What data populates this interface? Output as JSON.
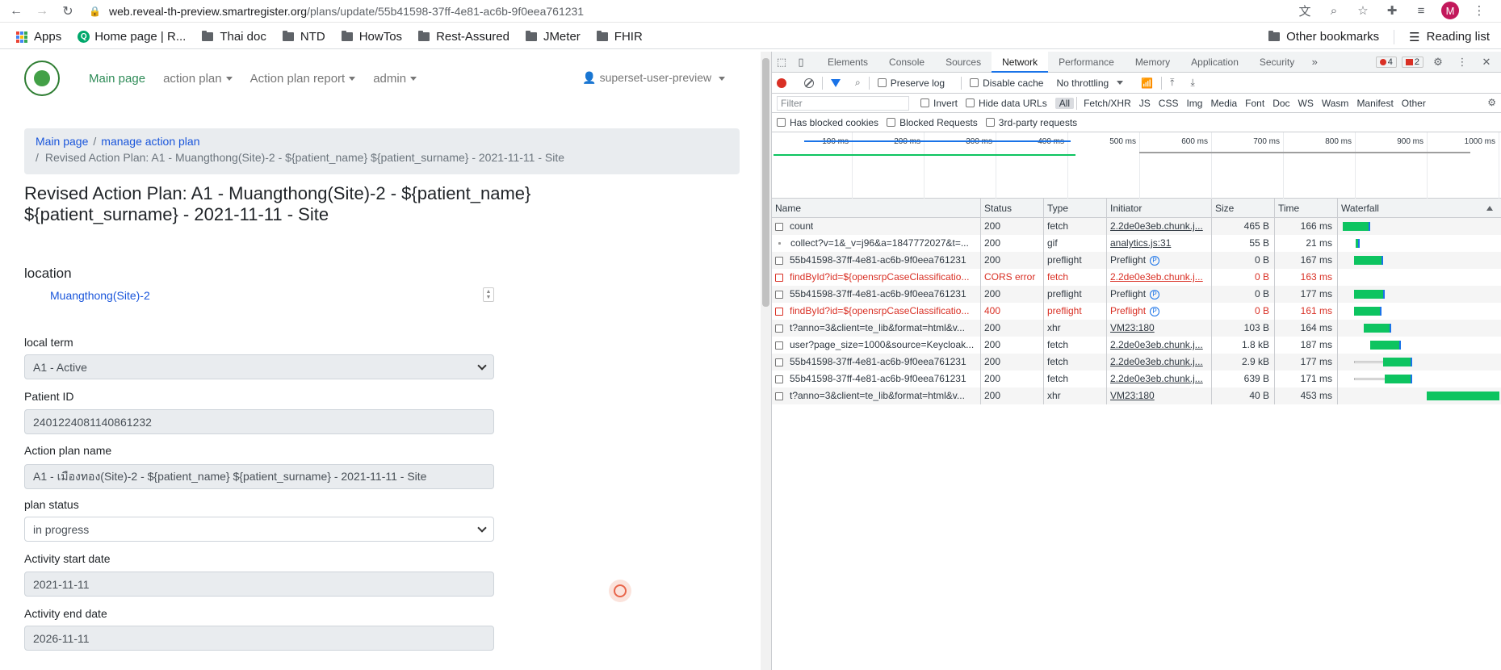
{
  "browser": {
    "url_host": "web.reveal-th-preview.smartregister.org",
    "url_path": "/plans/update/55b41598-37ff-4e81-ac6b-9f0eea761231",
    "avatar_letter": "M"
  },
  "bookmarks": {
    "items": [
      "Apps",
      "Home page | R...",
      "Thai doc",
      "NTD",
      "HowTos",
      "Rest-Assured",
      "JMeter",
      "FHIR"
    ],
    "other": "Other bookmarks",
    "reading": "Reading list"
  },
  "nav": {
    "main": "Main page",
    "action_plan": "action plan",
    "action_plan_report": "Action plan report",
    "admin": "admin",
    "user": "superset-user-preview"
  },
  "breadcrumb": {
    "main": "Main page",
    "manage": "manage action plan",
    "current": "Revised Action Plan: A1 - Muangthong(Site)-2 - ${patient_name} ${patient_surname} - 2021-11-11 - Site"
  },
  "title": "Revised Action Plan: A1 - Muangthong(Site)-2 - ${patient_name} ${patient_surname} - 2021-11-11 - Site",
  "form": {
    "location_label": "location",
    "location_value": "Muangthong(Site)-2",
    "local_term_label": "local term",
    "local_term_value": "A1 - Active",
    "patient_id_label": "Patient ID",
    "patient_id_value": "2401224081140861232",
    "plan_name_label": "Action plan name",
    "plan_name_value": "A1 - เมืองทอง(Site)-2 - ${patient_name} ${patient_surname} - 2021-11-11 - Site",
    "plan_status_label": "plan status",
    "plan_status_value": "in progress",
    "start_label": "Activity start date",
    "start_value": "2021-11-11",
    "end_label": "Activity end date",
    "end_value": "2026-11-11"
  },
  "devtools": {
    "tabs": [
      "Elements",
      "Console",
      "Sources",
      "Network",
      "Performance",
      "Memory",
      "Application",
      "Security"
    ],
    "active_tab": "Network",
    "error_count": "4",
    "issue_count": "2",
    "preserve_log": "Preserve log",
    "disable_cache": "Disable cache",
    "throttling": "No throttling",
    "filter_placeholder": "Filter",
    "invert": "Invert",
    "hide_data_urls": "Hide data URLs",
    "types": [
      "All",
      "Fetch/XHR",
      "JS",
      "CSS",
      "Img",
      "Media",
      "Font",
      "Doc",
      "WS",
      "Wasm",
      "Manifest",
      "Other"
    ],
    "blocked_cookies": "Has blocked cookies",
    "blocked_requests": "Blocked Requests",
    "third_party": "3rd-party requests",
    "timeline_ticks": [
      "100 ms",
      "200 ms",
      "300 ms",
      "400 ms",
      "500 ms",
      "600 ms",
      "700 ms",
      "800 ms",
      "900 ms",
      "1000 ms"
    ],
    "columns": [
      "Name",
      "Status",
      "Type",
      "Initiator",
      "Size",
      "Time",
      "Waterfall"
    ],
    "requests": [
      {
        "name": "count",
        "status": "200",
        "type": "fetch",
        "initiator": "2.2de0e3eb.chunk.j...",
        "size": "465 B",
        "time": "166 ms",
        "error": false
      },
      {
        "name": "collect?v=1&_v=j96&a=1847772027&t=...",
        "status": "200",
        "type": "gif",
        "initiator": "analytics.js:31",
        "size": "55 B",
        "time": "21 ms",
        "error": false
      },
      {
        "name": "55b41598-37ff-4e81-ac6b-9f0eea761231",
        "status": "200",
        "type": "preflight",
        "initiator": "Preflight",
        "size": "0 B",
        "time": "167 ms",
        "error": false
      },
      {
        "name": "findById?id=${opensrpCaseClassificatio...",
        "status": "CORS error",
        "type": "fetch",
        "initiator": "2.2de0e3eb.chunk.j...",
        "size": "0 B",
        "time": "163 ms",
        "error": true
      },
      {
        "name": "55b41598-37ff-4e81-ac6b-9f0eea761231",
        "status": "200",
        "type": "preflight",
        "initiator": "Preflight",
        "size": "0 B",
        "time": "177 ms",
        "error": false
      },
      {
        "name": "findById?id=${opensrpCaseClassificatio...",
        "status": "400",
        "type": "preflight",
        "initiator": "Preflight",
        "size": "0 B",
        "time": "161 ms",
        "error": true
      },
      {
        "name": "t?anno=3&client=te_lib&format=html&v...",
        "status": "200",
        "type": "xhr",
        "initiator": "VM23:180",
        "size": "103 B",
        "time": "164 ms",
        "error": false
      },
      {
        "name": "user?page_size=1000&source=Keycloak...",
        "status": "200",
        "type": "fetch",
        "initiator": "2.2de0e3eb.chunk.j...",
        "size": "1.8 kB",
        "time": "187 ms",
        "error": false
      },
      {
        "name": "55b41598-37ff-4e81-ac6b-9f0eea761231",
        "status": "200",
        "type": "fetch",
        "initiator": "2.2de0e3eb.chunk.j...",
        "size": "2.9 kB",
        "time": "177 ms",
        "error": false
      },
      {
        "name": "55b41598-37ff-4e81-ac6b-9f0eea761231",
        "status": "200",
        "type": "fetch",
        "initiator": "2.2de0e3eb.chunk.j...",
        "size": "639 B",
        "time": "171 ms",
        "error": false
      },
      {
        "name": "t?anno=3&client=te_lib&format=html&v...",
        "status": "200",
        "type": "xhr",
        "initiator": "VM23:180",
        "size": "40 B",
        "time": "453 ms",
        "error": false
      }
    ]
  }
}
